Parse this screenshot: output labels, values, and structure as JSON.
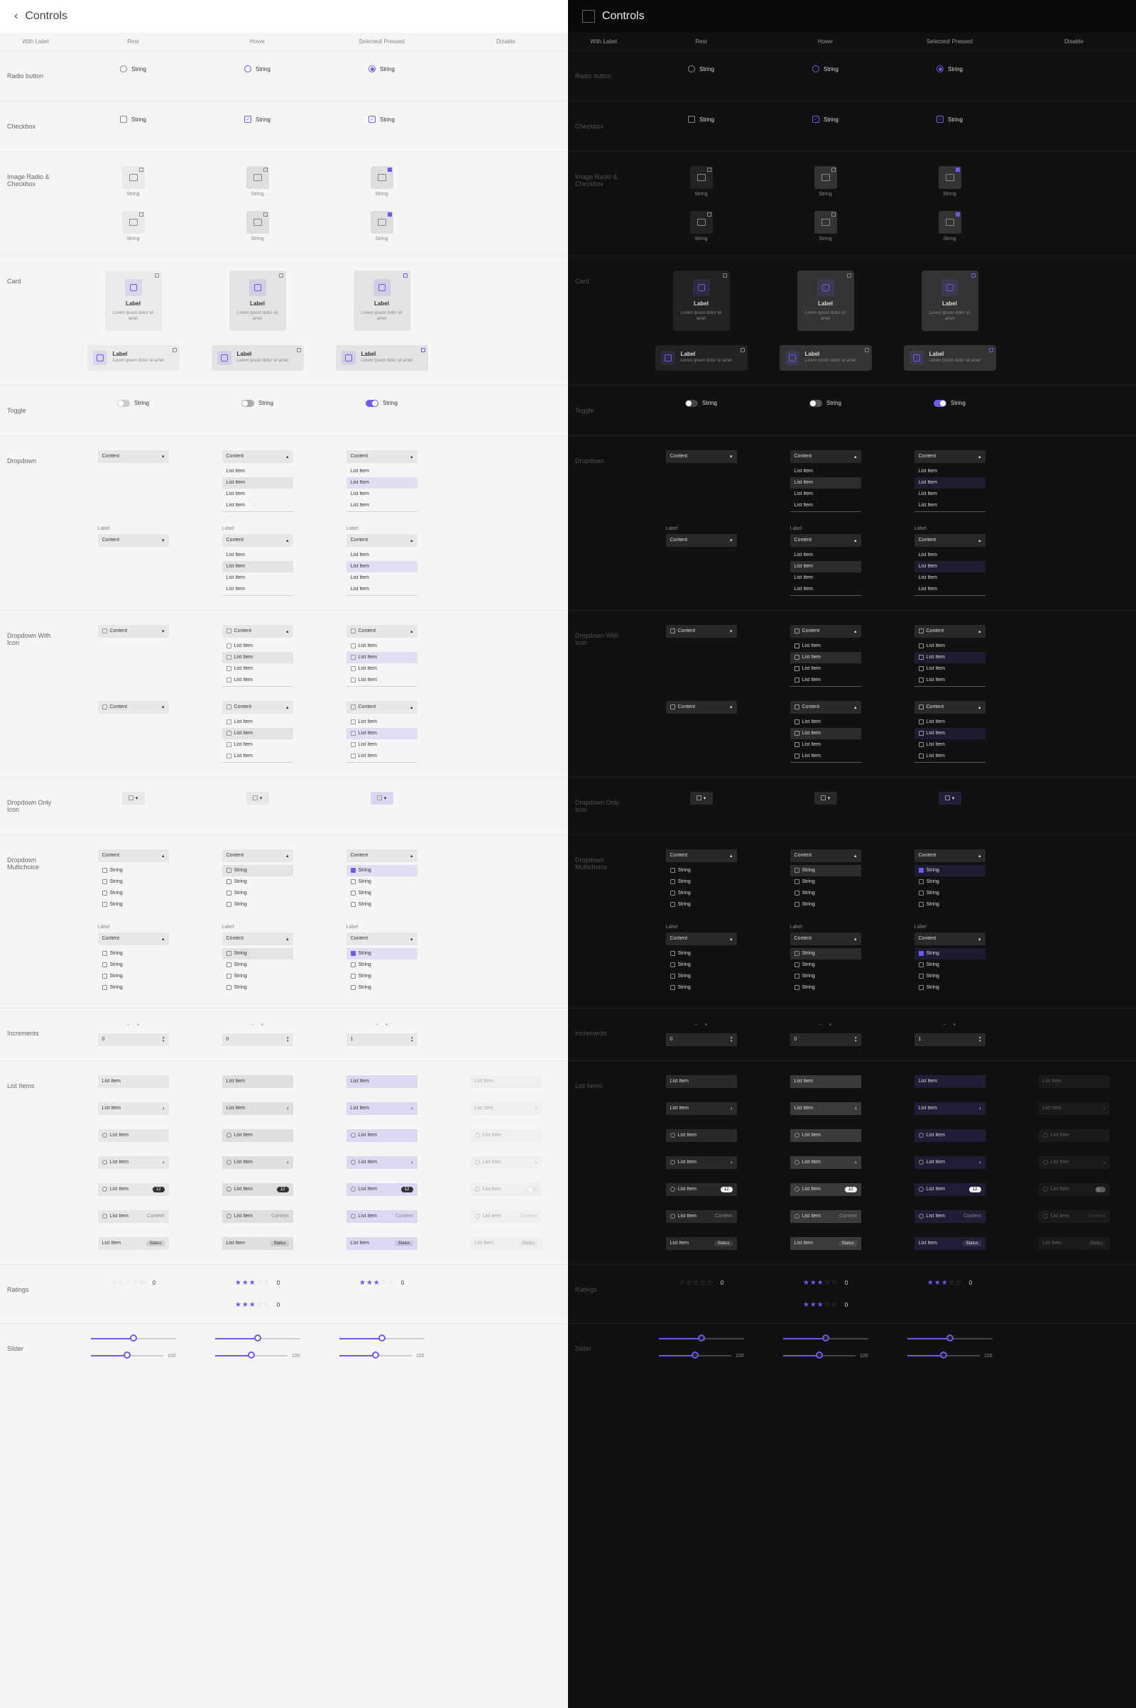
{
  "header": {
    "title": "Controls",
    "back_icon": "back"
  },
  "states": {
    "with_label": "With Label",
    "rest": "Rest",
    "hover": "Hover",
    "selected": "Selected/\nPressed",
    "disable": "Disable"
  },
  "rows": {
    "radio": {
      "label": "Radio button",
      "string": "String"
    },
    "checkbox": {
      "label": "Checkbox",
      "string": "String"
    },
    "image_radio": {
      "label": "Image Radio & Checkbox",
      "string": "String"
    },
    "card": {
      "label": "Card",
      "title": "Label",
      "desc": "Lorem ipsum dolor sit amet"
    },
    "toggle": {
      "label": "Toggle",
      "string": "String"
    },
    "dropdown": {
      "label": "Dropdown",
      "field_label": "Label",
      "content": "Content",
      "list_item": "List Item"
    },
    "dropdown_icon": {
      "label": "Dropdown With Icon",
      "content": "Content",
      "list_item": "List Item"
    },
    "dropdown_only_icon": {
      "label": "Dropdown Only Icon"
    },
    "dropdown_multi": {
      "label": "Dropdown Multichoice",
      "field_label": "Label",
      "content": "Content",
      "string": "String"
    },
    "increments": {
      "label": "Increments",
      "val0": "0",
      "val1": "1"
    },
    "list_items": {
      "label": "List Items",
      "item": "List Item",
      "badge": "12",
      "content": "Content",
      "status": "Status"
    },
    "ratings": {
      "label": "Ratings",
      "count": "0"
    },
    "slider": {
      "label": "Slider",
      "max": "100"
    }
  }
}
